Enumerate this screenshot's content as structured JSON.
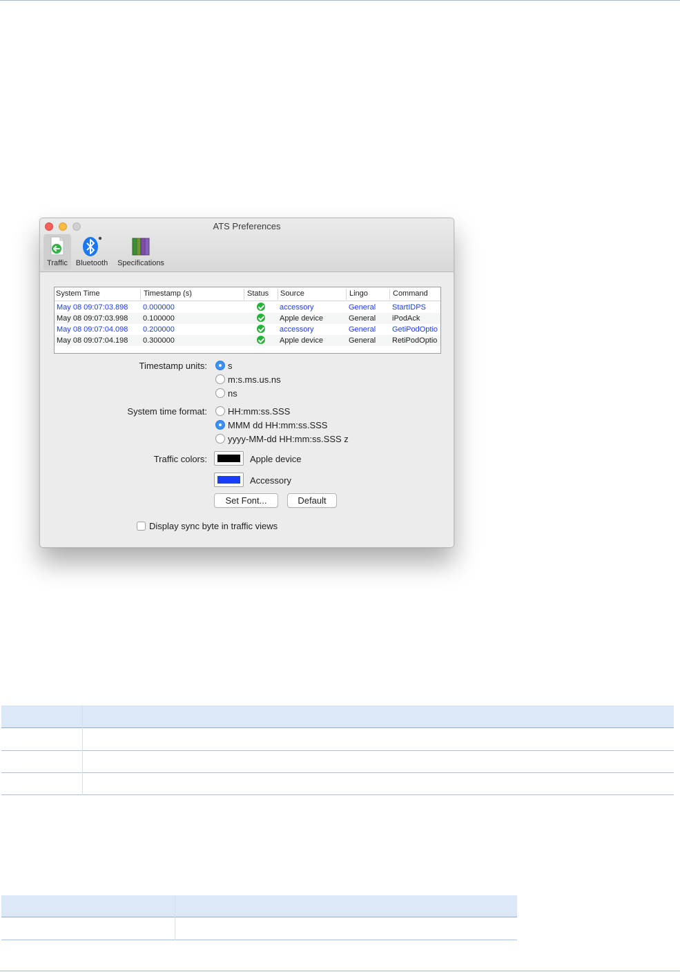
{
  "window": {
    "title": "ATS Preferences",
    "toolbar": [
      {
        "label": "Traffic",
        "icon": "traffic-icon",
        "selected": true
      },
      {
        "label": "Bluetooth",
        "icon": "bluetooth-icon",
        "selected": false
      },
      {
        "label": "Specifications",
        "icon": "books-icon",
        "selected": false
      }
    ]
  },
  "traffic_table": {
    "headers": [
      "System Time",
      "Timestamp (s)",
      "Status",
      "Source",
      "Lingo",
      "Command"
    ],
    "rows": [
      {
        "system_time": "May 08 09:07:03.898",
        "timestamp": "0.000000",
        "status": "ok",
        "source": "accessory",
        "lingo": "General",
        "command": "StartIDPS",
        "color": "#1a3df5"
      },
      {
        "system_time": "May 08 09:07:03.998",
        "timestamp": "0.100000",
        "status": "ok",
        "source": "Apple device",
        "lingo": "General",
        "command": "iPodAck",
        "color": "#1e1e1e"
      },
      {
        "system_time": "May 08 09:07:04.098",
        "timestamp": "0.200000",
        "status": "ok",
        "source": "accessory",
        "lingo": "General",
        "command": "GetiPodOptio",
        "color": "#1a3df5"
      },
      {
        "system_time": "May 08 09:07:04.198",
        "timestamp": "0.300000",
        "status": "ok",
        "source": "Apple device",
        "lingo": "General",
        "command": "RetiPodOptio",
        "color": "#1e1e1e"
      }
    ]
  },
  "form": {
    "timestamp_units_label": "Timestamp units:",
    "timestamp_units": [
      {
        "label": "s",
        "selected": true
      },
      {
        "label": "m:s.ms.us.ns",
        "selected": false
      },
      {
        "label": "ns",
        "selected": false
      }
    ],
    "system_time_format_label": "System time format:",
    "system_time_formats": [
      {
        "label": "HH:mm:ss.SSS",
        "selected": false
      },
      {
        "label": "MMM dd HH:mm:ss.SSS",
        "selected": true
      },
      {
        "label": "yyyy-MM-dd HH:mm:ss.SSS z",
        "selected": false
      }
    ],
    "traffic_colors_label": "Traffic colors:",
    "apple_device_label": "Apple device",
    "apple_device_color": "#000000",
    "accessory_label": "Accessory",
    "accessory_color": "#1a3df5",
    "set_font_label": "Set Font...",
    "default_label": "Default",
    "sync_byte_label": "Display sync byte in traffic views",
    "sync_byte_checked": false
  }
}
